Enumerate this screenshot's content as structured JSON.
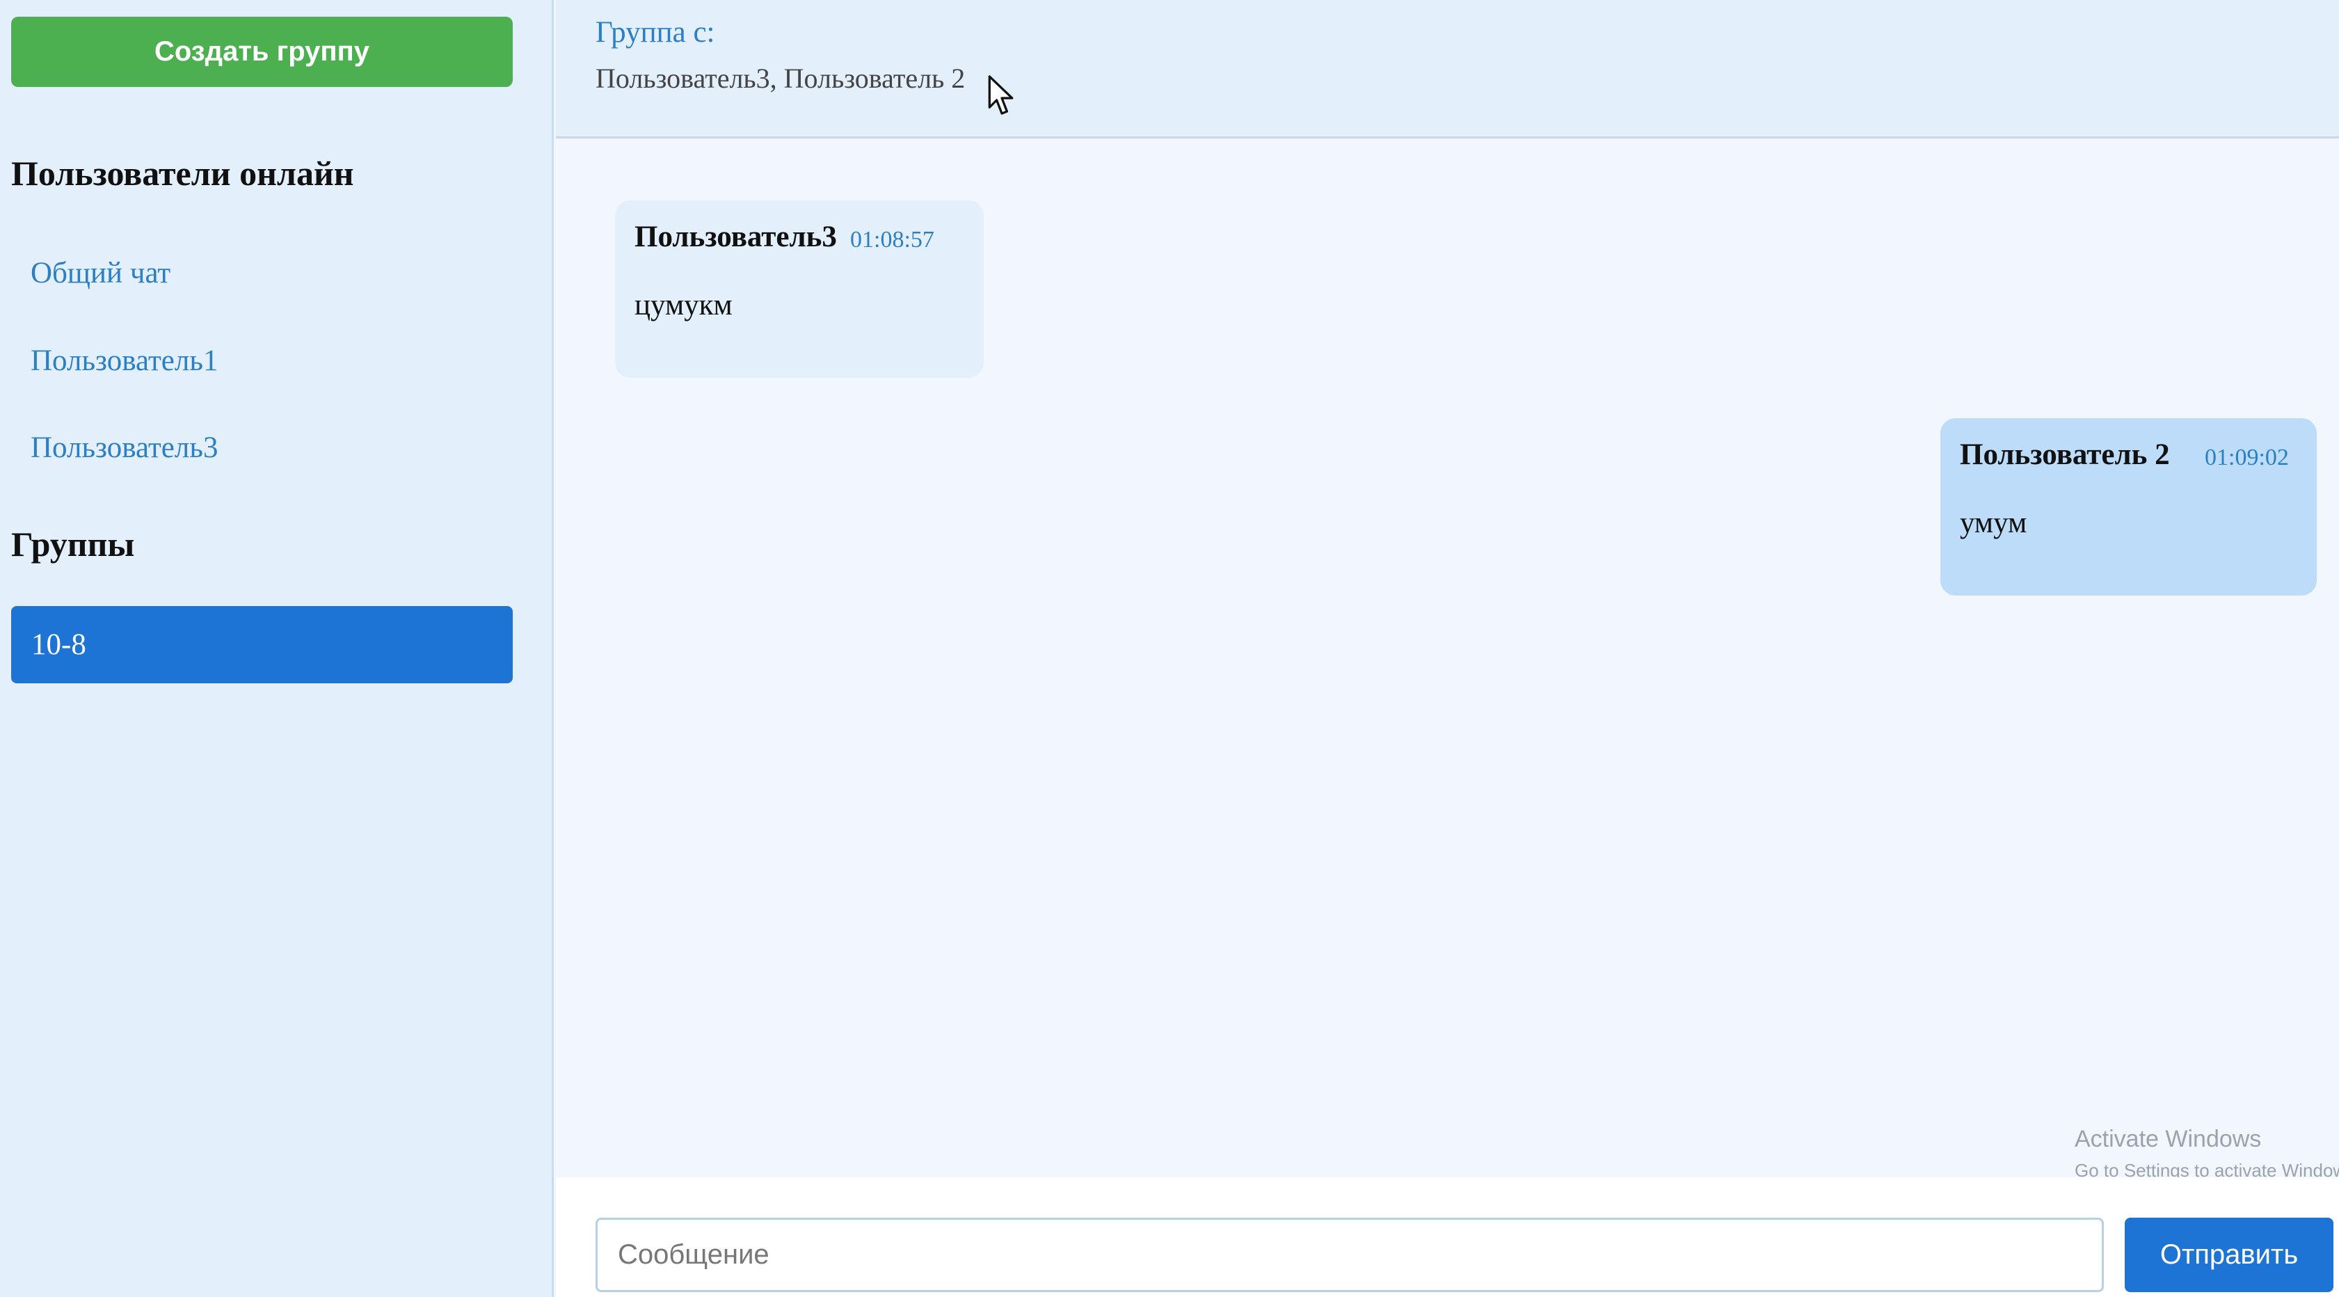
{
  "sidebar": {
    "create_group_label": "Создать группу",
    "users_title": "Пользователи онлайн",
    "users": [
      {
        "label": "Общий чат"
      },
      {
        "label": "Пользователь1"
      },
      {
        "label": "Пользователь3"
      }
    ],
    "groups_title": "Группы",
    "groups": [
      {
        "label": "10-8",
        "selected": true
      }
    ]
  },
  "chat": {
    "header_label": "Группа с:",
    "header_members": "Пользователь3, Пользователь 2",
    "messages": [
      {
        "author": "Пользователь3",
        "time": "01:08:57",
        "text": "цумукм",
        "direction": "incoming"
      },
      {
        "author": "Пользователь 2",
        "time": "01:09:02",
        "text": "умум",
        "direction": "outgoing"
      }
    ]
  },
  "composer": {
    "placeholder": "Сообщение",
    "value": "",
    "send_label": "Отправить"
  },
  "watermark": {
    "line1": "Activate Windows",
    "line2": "Go to Settings to activate Windows."
  },
  "colors": {
    "create_button": "#4caf50",
    "accent": "#1e74d4",
    "link": "#2b7fc2",
    "sidebar_bg": "#e3f0fc",
    "outgoing_bubble": "#bcdcf9",
    "incoming_bubble": "#e3f0fc"
  },
  "icons": {
    "cursor": "mouse-pointer-icon"
  }
}
